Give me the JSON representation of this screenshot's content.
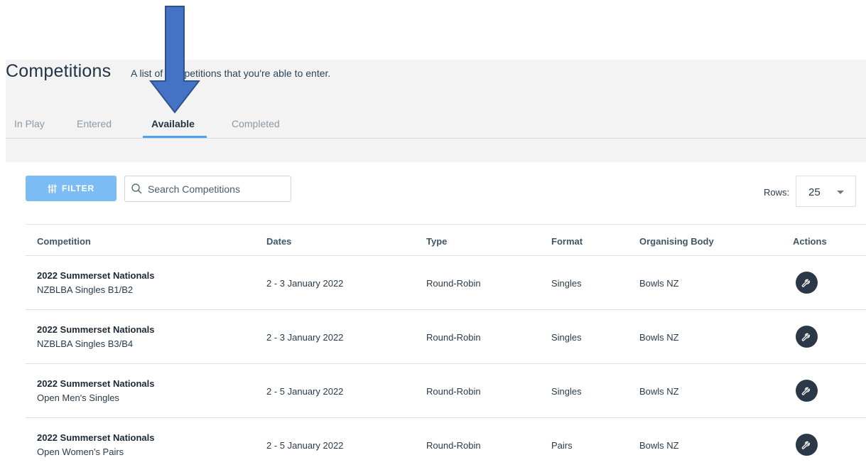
{
  "page": {
    "title": "Competitions",
    "subtitle": "A list of competitions that you're able to enter."
  },
  "tabs": [
    {
      "label": "In Play",
      "active": false
    },
    {
      "label": "Entered",
      "active": false
    },
    {
      "label": "Available",
      "active": true
    },
    {
      "label": "Completed",
      "active": false
    }
  ],
  "toolbar": {
    "filter_label": "FILTER",
    "search_placeholder": "Search Competitions",
    "rows_label": "Rows:",
    "rows_value": "25"
  },
  "table": {
    "headers": {
      "competition": "Competition",
      "dates": "Dates",
      "type": "Type",
      "format": "Format",
      "organising_body": "Organising Body",
      "actions": "Actions"
    },
    "rows": [
      {
        "name": "2022 Summerset Nationals",
        "event": "NZBLBA Singles B1/B2",
        "dates": "2 - 3 January 2022",
        "type": "Round-Robin",
        "format": "Singles",
        "body": "Bowls NZ"
      },
      {
        "name": "2022 Summerset Nationals",
        "event": "NZBLBA Singles B3/B4",
        "dates": "2 - 3 January 2022",
        "type": "Round-Robin",
        "format": "Singles",
        "body": "Bowls NZ"
      },
      {
        "name": "2022 Summerset Nationals",
        "event": "Open Men's Singles",
        "dates": "2 - 5 January 2022",
        "type": "Round-Robin",
        "format": "Singles",
        "body": "Bowls NZ"
      },
      {
        "name": "2022 Summerset Nationals",
        "event": "Open Women's Pairs",
        "dates": "2 - 5 January 2022",
        "type": "Round-Robin",
        "format": "Pairs",
        "body": "Bowls NZ"
      }
    ]
  },
  "colors": {
    "accent": "#4aa3f0",
    "filter_button": "#7cbcf5",
    "action_button": "#2b3848",
    "annotation_arrow": "#4472c4"
  },
  "icons": {
    "filter": "sliders-icon",
    "search": "search-icon",
    "action": "wrench-icon",
    "annotation": "down-arrow-icon"
  }
}
